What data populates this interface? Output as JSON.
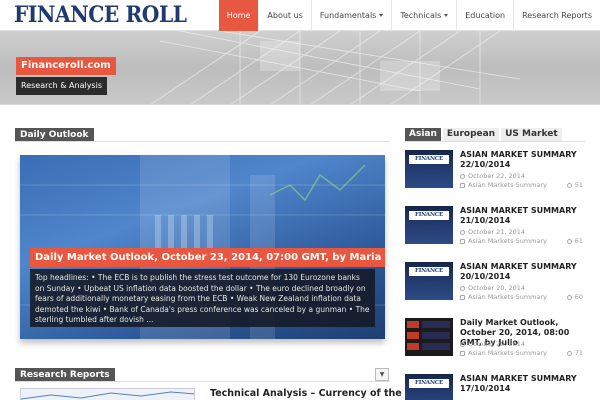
{
  "site": {
    "logo": "FINANCE ROLL"
  },
  "nav": [
    {
      "label": "Home",
      "active": true
    },
    {
      "label": "About us"
    },
    {
      "label": "Fundamentals"
    },
    {
      "label": "Technicals"
    },
    {
      "label": "Education"
    },
    {
      "label": "Research Reports"
    }
  ],
  "banner": {
    "brand": "Financeroll.com",
    "tagline": "Research & Analysis"
  },
  "daily_outlook": {
    "heading": "Daily Outlook",
    "title": "Daily Market Outlook, October 23, 2014, 07:00 GMT, by Maria",
    "excerpt": "Top headlines:    • The ECB is to publish the stress test outcome for 130 Eurozone banks on Sunday • Upbeat US inflation data boosted the dollar • The euro declined broadly on fears of additionally monetary easing from the ECB • Weak New Zealand inflation data demoted the kiwi • Bank of Canada's press conference was canceled by a gunman • The sterling tumbled after dovish ..."
  },
  "research_reports": {
    "heading": "Research Reports",
    "first_title": "Technical Analysis – Currency of the"
  },
  "side_tabs": [
    "Asian",
    "European",
    "US Market"
  ],
  "side_items": [
    {
      "thumb": "FINANCE ROLL",
      "title": "ASIAN MARKET SUMMARY 22/10/2014",
      "date": "October 22, 2014",
      "category": "Asian Markets Summary",
      "views": "51"
    },
    {
      "thumb": "FINANCE ROLL",
      "title": "ASIAN MARKET SUMMARY 21/10/2014",
      "date": "October 21, 2014",
      "category": "Asian Markets Summary",
      "views": "61"
    },
    {
      "thumb": "FINANCE ROLL",
      "title": "ASIAN MARKET SUMMARY 20/10/2014",
      "date": "October 20, 2014",
      "category": "Asian Markets Summary",
      "views": "60"
    },
    {
      "thumb": "",
      "title": "Daily Market Outlook, October 20, 2014, 08:00 GMT, by Julio",
      "date": "October 20, 2014",
      "category": "Asian Markets Summary",
      "views": "71"
    },
    {
      "thumb": "FINANCE ROLL",
      "title": "ASIAN MARKET SUMMARY 17/10/2014",
      "date": "",
      "category": "",
      "views": ""
    }
  ],
  "colors": {
    "accent": "#e8573f",
    "dark_label": "#555555",
    "logo": "#1f3a6e"
  }
}
